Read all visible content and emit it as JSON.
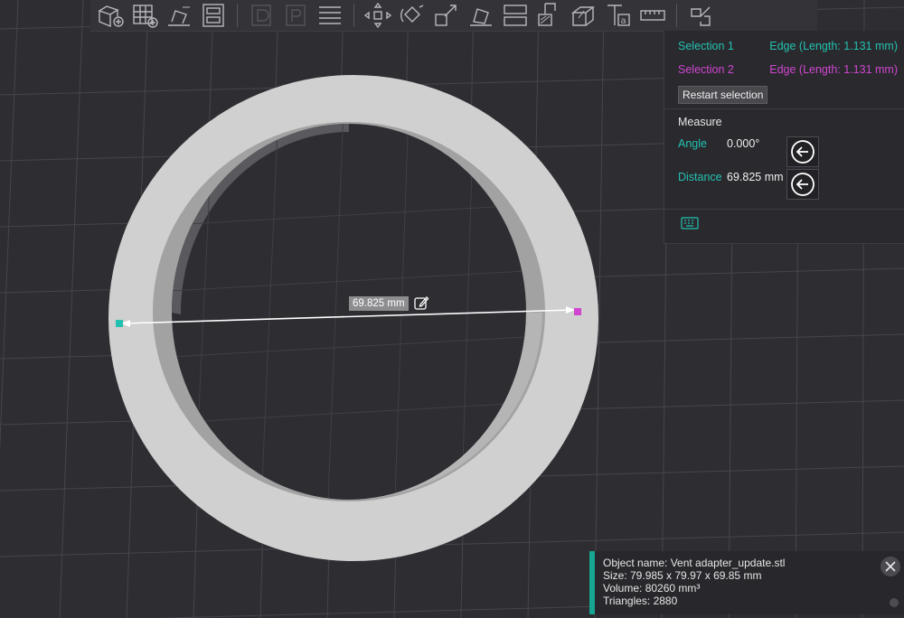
{
  "selection": {
    "sel1_label": "Selection 1",
    "sel1_value": "Edge (Length: 1.131 mm)",
    "sel2_label": "Selection 2",
    "sel2_value": "Edge (Length: 1.131 mm)",
    "restart_label": "Restart selection"
  },
  "measure": {
    "title": "Measure",
    "angle_label": "Angle",
    "angle_value": "0.000°",
    "distance_label": "Distance",
    "distance_value": "69.825 mm"
  },
  "viewport": {
    "dimension_label": "69.825 mm"
  },
  "object_info": {
    "name": "Object name: Vent adapter_update.stl",
    "size": "Size: 79.985 x 79.97 x 69.85 mm",
    "volume": "Volume: 80260 mm³",
    "triangles": "Triangles: 2880"
  },
  "colors": {
    "selection1": "#22c1b0",
    "selection2": "#d045d0",
    "accent": "#17a692",
    "background": "#2d2d32"
  },
  "toolbar_icons": [
    "add-object-icon",
    "arrange-grid-icon",
    "auto-orient-icon",
    "split-layout-icon",
    "assembly-icon",
    "plate-icon",
    "layers-icon",
    "move-icon",
    "rotate-icon",
    "scale-icon",
    "lay-on-face-icon",
    "cut-icon",
    "seam-paint-icon",
    "support-paint-icon",
    "emboss-text-icon",
    "measure-icon",
    "assembly-view-icon"
  ]
}
